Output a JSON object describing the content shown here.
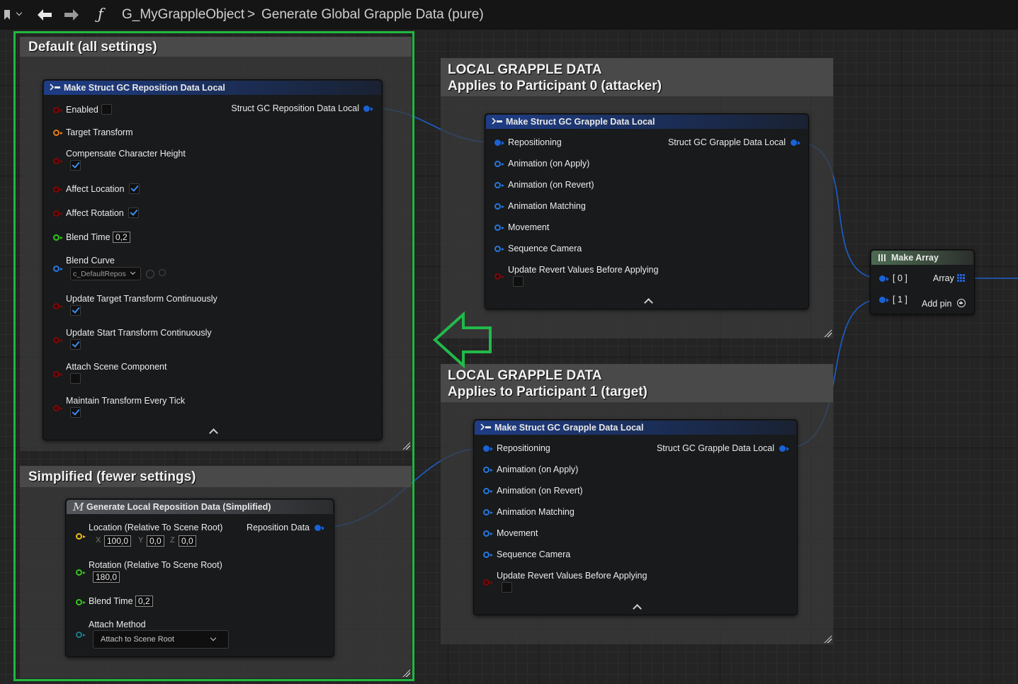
{
  "breadcrumb": {
    "object": "G_MyGrappleObject",
    "separator": ">",
    "function": "Generate Global Grapple Data (pure)",
    "function_icon": "ƒ"
  },
  "comments": {
    "default": "Default (all settings)",
    "simplified": "Simplified (fewer settings)",
    "attacker_line1": "LOCAL GRAPPLE DATA",
    "attacker_line2": "Applies to Participant 0 (attacker)",
    "target_line1": "LOCAL GRAPPLE DATA",
    "target_line2": "Applies to Participant 1 (target)"
  },
  "reposition_node": {
    "title": "Make Struct GC Reposition Data Local",
    "output": "Struct GC Reposition Data Local",
    "enabled": "Enabled",
    "target_transform": "Target Transform",
    "compensate": "Compensate Character Height",
    "affect_location": "Affect Location",
    "affect_rotation": "Affect Rotation",
    "blend_time": "Blend Time",
    "blend_time_value": "0,2",
    "blend_curve": "Blend Curve",
    "blend_curve_value": "c_DefaultRepos",
    "update_target": "Update Target Transform Continuously",
    "update_start": "Update Start Transform Continuously",
    "attach_scene": "Attach Scene Component",
    "maintain": "Maintain Transform Every Tick",
    "checks": {
      "enabled": false,
      "compensate": true,
      "affect_location": true,
      "affect_rotation": true,
      "update_target": true,
      "update_start": true,
      "attach_scene": false,
      "maintain": true
    }
  },
  "grapple_node_0": {
    "title": "Make Struct GC Grapple Data Local",
    "output": "Struct GC Grapple Data Local",
    "pins": [
      "Repositioning",
      "Animation (on Apply)",
      "Animation (on Revert)",
      "Animation Matching",
      "Movement",
      "Sequence Camera"
    ],
    "update_revert": "Update Revert Values Before Applying"
  },
  "grapple_node_1": {
    "title": "Make Struct GC Grapple Data Local",
    "output": "Struct GC Grapple Data Local",
    "pins": [
      "Repositioning",
      "Animation (on Apply)",
      "Animation (on Revert)",
      "Animation Matching",
      "Movement",
      "Sequence Camera"
    ],
    "update_revert": "Update Revert Values Before Applying"
  },
  "make_array": {
    "title": "Make Array",
    "pin0": "[ 0 ]",
    "pin1": "[ 1 ]",
    "output": "Array",
    "add_pin": "Add pin"
  },
  "simplified_node": {
    "title": "Generate Local Reposition Data (Simplified)",
    "macro_icon": "M",
    "output": "Reposition Data",
    "location": "Location (Relative To Scene Root)",
    "x_label": "X",
    "x": "100,0",
    "y_label": "Y",
    "y": "0,0",
    "z_label": "Z",
    "z": "0,0",
    "rotation": "Rotation (Relative To Scene Root)",
    "rotation_value": "180,0",
    "blend_time": "Blend Time",
    "blend_time_value": "0,2",
    "attach_method": "Attach Method",
    "attach_method_value": "Attach to Scene Root"
  },
  "colors": {
    "selection_outline": "#1fb83f",
    "struct_pin": "#1a62d6",
    "bool_pin": "#7a0a0a",
    "vector_pin": "#f2bc12",
    "rotator_pin": "#35c81b",
    "float_pin": "#35c81b",
    "transform_pin": "#e77b19",
    "object_pin": "#2878e0"
  }
}
